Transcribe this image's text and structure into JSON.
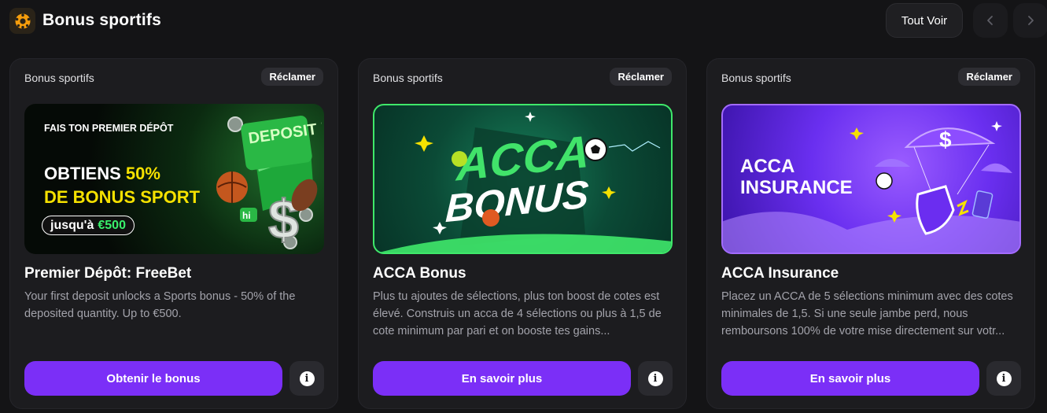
{
  "header": {
    "title": "Bonus sportifs",
    "see_all_label": "Tout Voir",
    "prev_icon": "chevron-left-icon",
    "next_icon": "chevron-right-icon",
    "logo_icon": "soccer-ball-icon"
  },
  "colors": {
    "accent": "#7b2ff7",
    "background": "#141416",
    "card": "#1c1c1f",
    "yellow": "#f5e100",
    "green": "#39f06b"
  },
  "cards": [
    {
      "category": "Bonus sportifs",
      "badge": "Réclamer",
      "title": "Premier Dépôt: FreeBet",
      "description": "Your first deposit unlocks a Sports bonus - 50% of the deposited quantity. Up to €500.",
      "cta": "Obtenir le bonus",
      "banner": {
        "line1": "FAIS TON PREMIER DÉPÔT",
        "line2_prefix": "OBTIENS ",
        "line2_highlight": "50%",
        "line3": "DE BONUS SPORT",
        "pill_prefix": "jusqu'à",
        "pill_amount": "€500",
        "badge_text": "DEPOSIT BONUS"
      }
    },
    {
      "category": "Bonus sportifs",
      "badge": "Réclamer",
      "title": "ACCA Bonus",
      "description": "Plus tu ajoutes de sélections, plus ton boost de cotes est élevé. Construis un acca de 4 sélections ou plus à 1,5 de cote minimum par pari et on booste tes gains...",
      "cta": "En savoir plus",
      "banner": {
        "word1": "ACCA",
        "word2": "BONUS"
      }
    },
    {
      "category": "Bonus sportifs",
      "badge": "Réclamer",
      "title": "ACCA Insurance",
      "description": "Placez un ACCA de 5 sélections minimum avec des cotes minimales de 1,5. Si une seule jambe perd, nous remboursons 100% de votre mise directement sur votr...",
      "cta": "En savoir plus",
      "banner": {
        "line1": "ACCA",
        "line2": "INSURANCE"
      }
    }
  ]
}
